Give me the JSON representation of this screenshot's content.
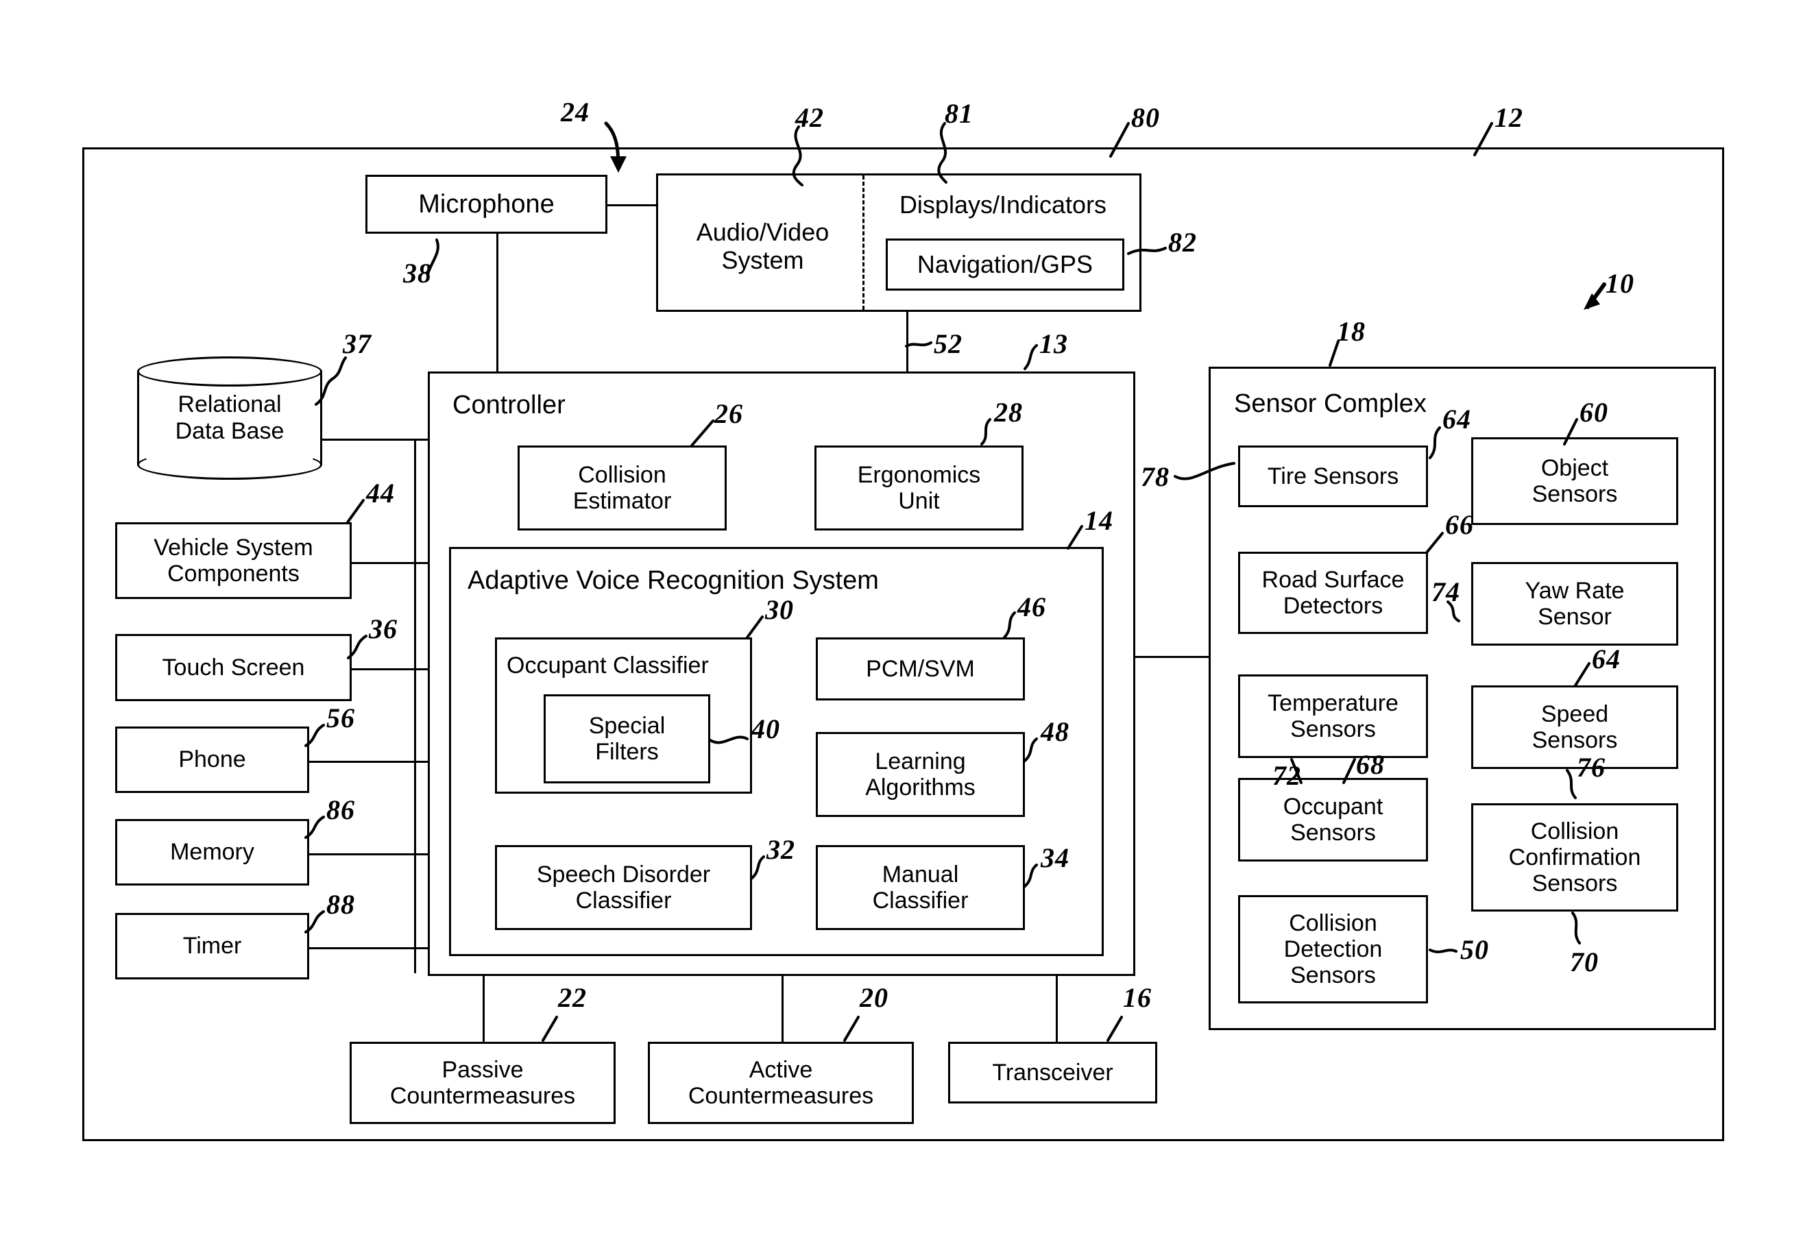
{
  "figure": {
    "type": "patent-block-diagram",
    "description": "Vehicle adaptive voice recognition and collision system block diagram"
  },
  "top_row": {
    "microphone": "Microphone",
    "audio_video_system": "Audio/Video\nSystem",
    "displays_indicators": "Displays/Indicators",
    "navigation_gps": "Navigation/GPS"
  },
  "left_column": {
    "relational_data_base": "Relational\nData Base",
    "vehicle_system_components": "Vehicle System\nComponents",
    "touch_screen": "Touch Screen",
    "phone": "Phone",
    "memory": "Memory",
    "timer": "Timer"
  },
  "controller": {
    "title": "Controller",
    "collision_estimator": "Collision\nEstimator",
    "ergonomics_unit": "Ergonomics\nUnit",
    "avrs": {
      "title": "Adaptive Voice Recognition System",
      "occupant_classifier": "Occupant Classifier",
      "special_filters": "Special\nFilters",
      "pcm_svm": "PCM/SVM",
      "learning_algorithms": "Learning\nAlgorithms",
      "speech_disorder_classifier": "Speech Disorder\nClassifier",
      "manual_classifier": "Manual\nClassifier"
    }
  },
  "sensor_complex": {
    "title": "Sensor Complex",
    "tire_sensors": "Tire Sensors",
    "object_sensors": "Object\nSensors",
    "road_surface_detectors": "Road Surface\nDetectors",
    "yaw_rate_sensor": "Yaw Rate\nSensor",
    "temperature_sensors": "Temperature\nSensors",
    "speed_sensors": "Speed\nSensors",
    "occupant_sensors": "Occupant\nSensors",
    "collision_confirmation_sensors": "Collision\nConfirmation\nSensors",
    "collision_detection_sensors": "Collision\nDetection\nSensors"
  },
  "bottom_row": {
    "passive_countermeasures": "Passive\nCountermeasures",
    "active_countermeasures": "Active\nCountermeasures",
    "transceiver": "Transceiver"
  },
  "reference_numerals": {
    "n24": "24",
    "n42": "42",
    "n81": "81",
    "n80": "80",
    "n12": "12",
    "n38": "38",
    "n82": "82",
    "n10": "10",
    "n37": "37",
    "n52": "52",
    "n13": "13",
    "n18": "18",
    "n26": "26",
    "n28": "28",
    "n64a": "64",
    "n60": "60",
    "n78": "78",
    "n66": "66",
    "n44": "44",
    "n14": "14",
    "n74": "74",
    "n36": "36",
    "n30": "30",
    "n46": "46",
    "n64b": "64",
    "n40": "40",
    "n48": "48",
    "n56": "56",
    "n72": "72",
    "n68": "68",
    "n76": "76",
    "n86": "86",
    "n32": "32",
    "n34": "34",
    "n88": "88",
    "n50": "50",
    "n70": "70",
    "n22": "22",
    "n20": "20",
    "n16": "16"
  },
  "colors": {
    "ink": "#000000",
    "paper": "#ffffff"
  }
}
